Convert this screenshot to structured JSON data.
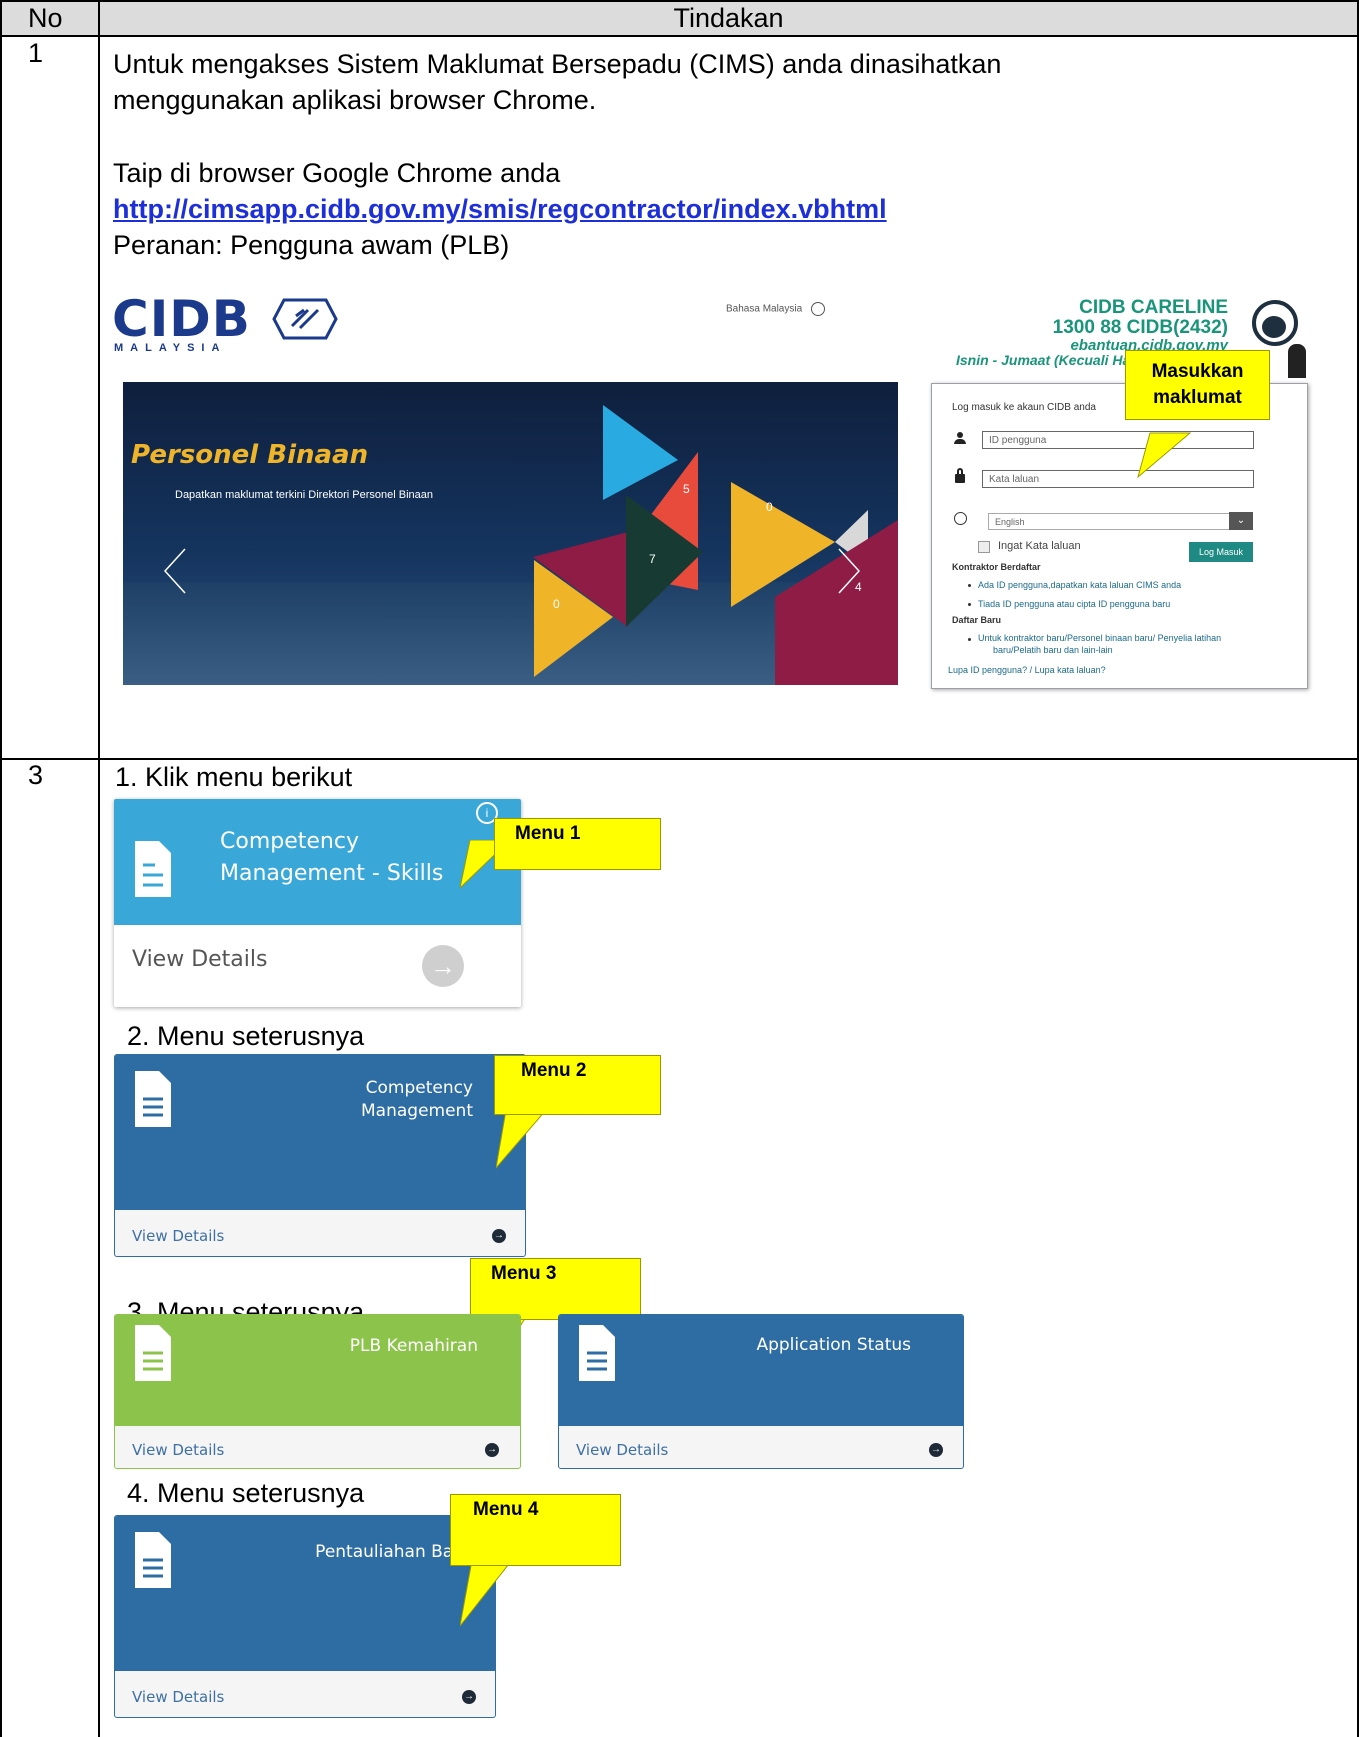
{
  "table": {
    "header_no": "No",
    "header_action": "Tindakan"
  },
  "row1": {
    "no": "1",
    "line1": "Untuk mengakses Sistem Maklumat Bersepadu (CIMS) anda dinasihatkan",
    "line2": "menggunakan aplikasi browser Chrome.",
    "line3": "Taip di browser Google Chrome anda",
    "url": "http://cimsapp.cidb.gov.my/smis/regcontractor/index.vbhtml",
    "line4": "Peranan: Pengguna awam (PLB)"
  },
  "cidb_page": {
    "logo": "CIDB",
    "logo_sub": "MALAYSIA",
    "language": "Bahasa Malaysia",
    "careline_title": "CIDB CARELINE",
    "careline_phone": "1300 88 CIDB(2432)",
    "careline_email": "ebantuan.cidb.gov.my",
    "careline_hours": "Isnin - Jumaat (Kecuali Ha",
    "banner_title": "Personel Binaan",
    "banner_subtitle": "Dapatkan maklumat terkini Direktori Personel Binaan",
    "banner_numbers": [
      "5",
      "0",
      "7",
      "0",
      "4"
    ],
    "login_title": "Log masuk ke akaun CIDB anda",
    "id_placeholder": "ID pengguna",
    "password_placeholder": "Kata laluan",
    "language_select": "English",
    "remember": "Ingat Kata laluan",
    "login_button": "Log Masuk",
    "registered_heading": "Kontraktor Berdaftar",
    "registered_link1": "Ada ID pengguna,dapatkan kata laluan CIMS anda",
    "registered_link2": "Tiada ID pengguna atau cipta ID pengguna baru",
    "new_heading": "Daftar Baru",
    "new_link_line1": "Untuk kontraktor baru/Personel binaan baru/ Penyelia latihan",
    "new_link_line2": "baru/Pelatih baru dan lain-lain",
    "forgot": "Lupa ID pengguna? / Lupa kata laluan?",
    "callout_line1": "Masukkan",
    "callout_line2": "maklumat"
  },
  "row3": {
    "no": "3",
    "step1": "1.  Klik menu berikut",
    "step2": "2.  Menu seterusnya",
    "step3": "3.  Menu seterusnya",
    "step4": "4.  Menu seterusnya",
    "tile1_line1": "Competency",
    "tile1_line2": "Management - Skills",
    "tile1_details": "View Details",
    "tile2_line1": "Competency",
    "tile2_line2": "Management",
    "tile3": "PLB Kemahiran",
    "tile4": "Application Status",
    "tile5": "Pentauliahan Baru",
    "view_details": "View Details",
    "menu1": "Menu 1",
    "menu2": "Menu 2",
    "menu3": "Menu 3",
    "menu4": "Menu 4"
  },
  "colors": {
    "tile_blue": "#2e6da4",
    "tile_light_blue": "#3aa7d9",
    "tile_green": "#8cc34b",
    "careline_green": "#19957a",
    "callout_yellow": "#ffff00"
  }
}
